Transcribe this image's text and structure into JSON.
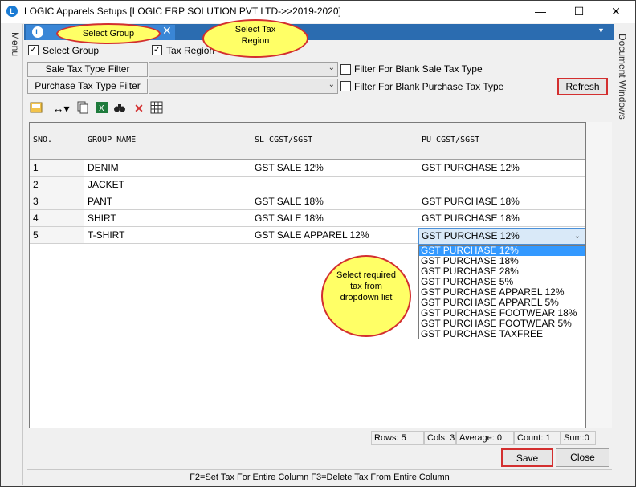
{
  "window": {
    "title": "LOGIC Apparels Setups  [LOGIC ERP SOLUTION PVT LTD->>2019-2020]",
    "minimize_glyph": "—",
    "maximize_glyph": "☐",
    "close_glyph": "✕"
  },
  "side_panels": {
    "left_label": "Menu",
    "right_label": "Document Windows"
  },
  "tab": {
    "close_glyph": "✕",
    "overflow_glyph": "▼"
  },
  "options": {
    "select_group_label": "Select Group",
    "tax_region_label": "Tax Region",
    "select_group_checked": true,
    "tax_region_checked": true
  },
  "filters": {
    "sale_tax_type_label": "Sale Tax Type Filter",
    "purchase_tax_type_label": "Purchase Tax Type Filter",
    "sale_tax_type_value": "",
    "purchase_tax_type_value": "",
    "blank_sale_label": "Filter For Blank Sale Tax Type",
    "blank_purchase_label": "Filter For Blank Purchase Tax Type",
    "blank_sale_checked": false,
    "blank_purchase_checked": false
  },
  "refresh_label": "Refresh",
  "toolbar": {
    "icons": [
      "save-layout-icon",
      "column-width-icon",
      "copy-icon",
      "excel-icon",
      "find-icon",
      "delete-icon",
      "grid-icon"
    ]
  },
  "grid": {
    "headers": [
      "SNO.",
      "GROUP NAME",
      "SL CGST/SGST",
      "PU CGST/SGST"
    ],
    "rows": [
      [
        "1",
        "DENIM",
        "GST SALE 12%",
        "GST PURCHASE 12%"
      ],
      [
        "2",
        "JACKET",
        "",
        ""
      ],
      [
        "3",
        "PANT",
        "GST SALE 18%",
        "GST PURCHASE 18%"
      ],
      [
        "4",
        "SHIRT",
        "GST SALE 18%",
        "GST PURCHASE 18%"
      ],
      [
        "5",
        "T-SHIRT",
        "GST SALE APPAREL 12%",
        "GST PURCHASE 12%"
      ]
    ]
  },
  "dropdown": {
    "selected_index": 0,
    "options": [
      "GST PURCHASE 12%",
      "GST PURCHASE 18%",
      "GST PURCHASE 28%",
      "GST PURCHASE 5%",
      "GST PURCHASE APPAREL 12%",
      "GST PURCHASE APPAREL 5%",
      "GST PURCHASE FOOTWEAR 18%",
      "GST PURCHASE FOOTWEAR 5%",
      "GST PURCHASE TAXFREE"
    ]
  },
  "status": {
    "rows": "Rows: 5",
    "cols": "Cols: 3",
    "average": "Average: 0",
    "count": "Count: 1",
    "sum": "Sum:0"
  },
  "buttons": {
    "save": "Save",
    "close": "Close"
  },
  "footer_text": "F2=Set Tax For Entire Column  F3=Delete Tax From Entire Column",
  "callouts": {
    "select_group": "Select  Group",
    "select_tax_region": "Select  Tax Region",
    "select_tax_dropdown": "Select  required tax  from dropdown  list"
  },
  "colors": {
    "tab_strip": "#2b6cb0",
    "highlight_border": "#d32f2f",
    "callout_fill": "#ffff66",
    "selection": "#3399ff"
  }
}
